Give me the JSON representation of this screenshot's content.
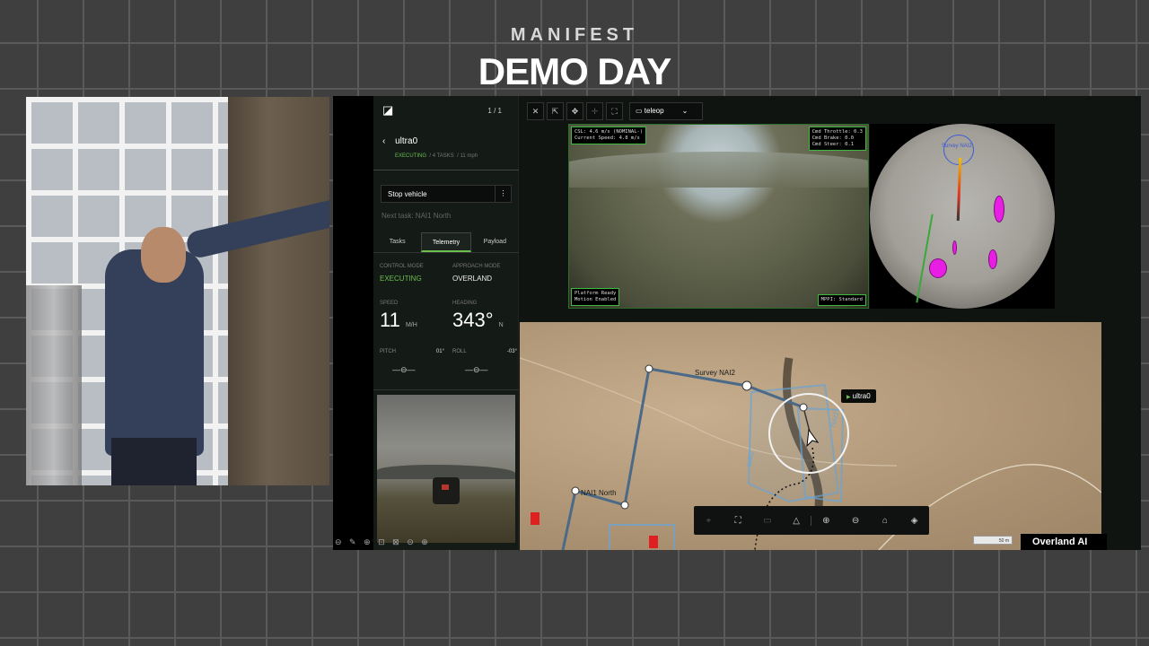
{
  "event": {
    "brand": "MANIFEST",
    "title": "DEMO DAY"
  },
  "panel": {
    "logo": "◪",
    "pager": "1 / 1",
    "vehicle_name": "ultra0",
    "status": "EXECUTING",
    "tasks": "4 TASKS",
    "speed_small": "11 mph",
    "stop_label": "Stop vehicle",
    "stop_menu": "⋮",
    "next_task": "Next task: NAI1 North",
    "tabs": [
      "Tasks",
      "Telemetry",
      "Payload"
    ],
    "active_tab": "Telemetry",
    "telemetry": {
      "control_mode_label": "CONTROL MODE",
      "control_mode": "EXECUTING",
      "approach_mode_label": "APPROACH MODE",
      "approach_mode": "OVERLAND",
      "speed_label": "SPEED",
      "speed": "11",
      "speed_unit": "M/H",
      "heading_label": "HEADING",
      "heading": "343°",
      "heading_unit": "N",
      "pitch_label": "PITCH",
      "pitch": "01°",
      "roll_label": "ROLL",
      "roll": "-03°",
      "pitch_indicator": "—⊖—",
      "roll_indicator": "—⊖—"
    },
    "tools": "⊖ ✎ ⊕ ⊡ ⊠ ⊝ ⊕"
  },
  "toolbar": {
    "close": "✕",
    "popout": "⇱",
    "move": "✥",
    "crosshair": "✛",
    "fullscreen": "⛶",
    "camera_select": "▭ teleop",
    "caret": "⌄"
  },
  "camera": {
    "overlay_tl": "CSL: 4.6 m/s (NOMINAL-)\nCurrent Speed: 4.8 m/s",
    "overlay_tr": "Cmd Throttle: 0.3\nCmd Brake: 0.0\nCmd Steer: 0.1",
    "overlay_bl": "Platform Ready\nMotion Enabled",
    "overlay_br": "MPPI: Standard"
  },
  "fisheye": {
    "label": "Survey NAI2"
  },
  "map": {
    "vehicle_chip": "ultra0",
    "vehicle_tri": "▶",
    "waypoint_survey": "Survey NAI2",
    "waypoint_north": "NAI1 North",
    "zone_label_1": "NAI2",
    "zone_label_2": "NAI2",
    "scale": "50 m",
    "controls": [
      "⌖",
      "⛶",
      "▭",
      "△",
      "⊕",
      "⊖",
      "⌂",
      "◈"
    ]
  },
  "watermark": "Overland AI",
  "colors": {
    "accent_green": "#6bbf4f",
    "overlay_border": "#3fb93f",
    "magenta": "#e91ee4"
  }
}
